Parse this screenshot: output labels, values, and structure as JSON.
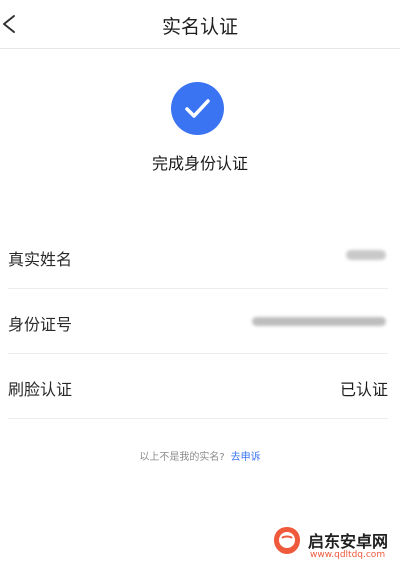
{
  "header": {
    "title": "实名认证",
    "back_icon": "chevron-left-icon"
  },
  "status": {
    "icon": "check-circle-icon",
    "color": "#3b74f2",
    "text": "完成身份认证"
  },
  "info_rows": [
    {
      "label": "真实姓名",
      "value": "",
      "masked": true
    },
    {
      "label": "身份证号",
      "value": "",
      "masked": true
    },
    {
      "label": "刷脸认证",
      "value": "已认证",
      "masked": false
    }
  ],
  "appeal": {
    "text": "以上不是我的实名?",
    "link": "去申诉"
  },
  "watermark": {
    "title": "启东安卓网",
    "url": "www.qdltdq.com"
  }
}
